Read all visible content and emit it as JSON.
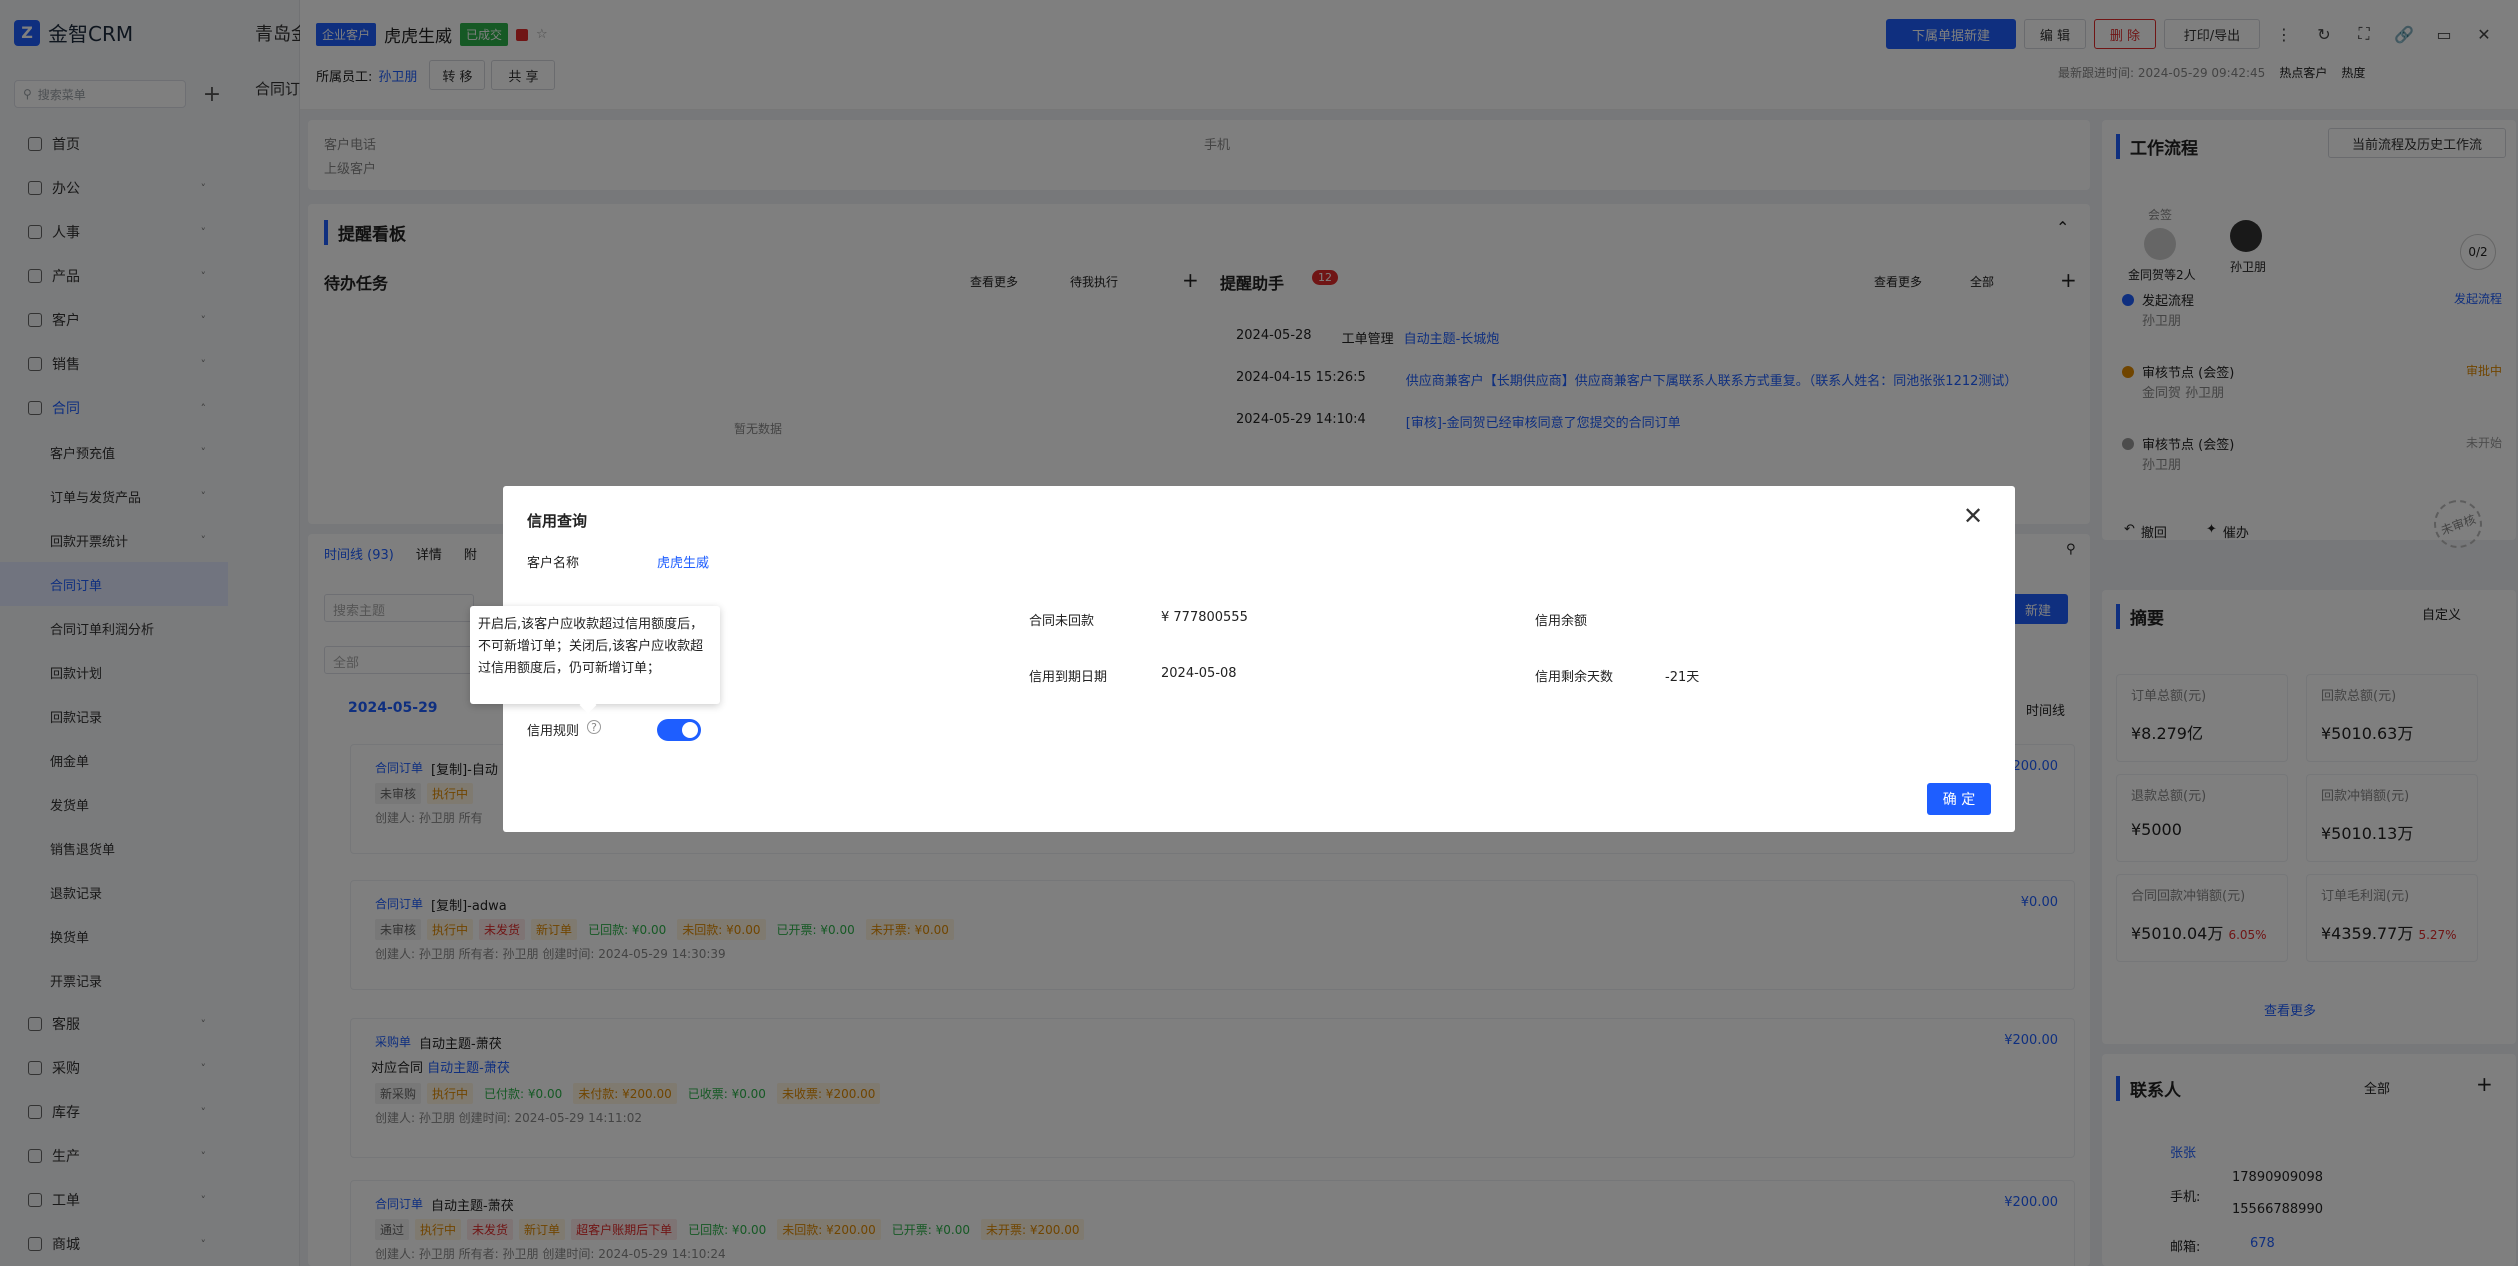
{
  "app": {
    "brand": "金智CRM",
    "search_placeholder": "搜索菜单",
    "top_tab": "青岛金",
    "sub_tab": "合同订"
  },
  "nav": [
    {
      "label": "首页"
    },
    {
      "label": "办公"
    },
    {
      "label": "人事"
    },
    {
      "label": "产品"
    },
    {
      "label": "客户"
    },
    {
      "label": "销售"
    },
    {
      "label": "合同"
    },
    {
      "label": "客户预充值",
      "sub": true
    },
    {
      "label": "订单与发货产品",
      "sub": true
    },
    {
      "label": "回款开票统计",
      "sub": true
    },
    {
      "label": "合同订单",
      "sub": true
    },
    {
      "label": "合同订单利润分析",
      "sub": true
    },
    {
      "label": "回款计划",
      "sub": true
    },
    {
      "label": "回款记录",
      "sub": true
    },
    {
      "label": "佣金单",
      "sub": true
    },
    {
      "label": "发货单",
      "sub": true
    },
    {
      "label": "销售退货单",
      "sub": true
    },
    {
      "label": "退款记录",
      "sub": true
    },
    {
      "label": "换货单",
      "sub": true
    },
    {
      "label": "开票记录",
      "sub": true
    },
    {
      "label": "客服"
    },
    {
      "label": "采购"
    },
    {
      "label": "库存"
    },
    {
      "label": "生产"
    },
    {
      "label": "工单"
    },
    {
      "label": "商城"
    }
  ],
  "header": {
    "tag_type": "企业客户",
    "customer_name": "虎虎生威",
    "tag_status": "已成交",
    "owner_label": "所属员工:",
    "owner": "孙卫朋",
    "transfer": "转 移",
    "share": "共 享",
    "new_order": "下属单据新建",
    "edit": "编 辑",
    "delete": "删 除",
    "print": "打印/导出",
    "latest_follow": "最新跟进时间: 2024-05-29 09:42:45",
    "hot_label": "热点客户",
    "heat": "热度"
  },
  "info": {
    "phone_label": "客户电话",
    "mobile_label": "手机",
    "parent_label": "上级客户"
  },
  "reminder_board": {
    "title": "提醒看板"
  },
  "todo": {
    "title": "待办任务",
    "more": "查看更多",
    "filter": "待我执行",
    "empty": "暂无数据"
  },
  "assistant": {
    "title": "提醒助手",
    "count": "12",
    "more": "查看更多",
    "filter": "全部",
    "items": [
      {
        "time": "2024-05-28",
        "type": "工单管理",
        "text": "自动主题-长城炮"
      },
      {
        "time": "2024-04-15 15:26:5",
        "type": "",
        "text": "供应商兼客户【长期供应商】供应商兼客户下属联系人联系方式重复。（联系人姓名：同池张张1212测试）"
      },
      {
        "time": "2024-05-29 14:10:4",
        "type": "",
        "text": "[审核]-金同贺已经审核同意了您提交的合同订单"
      }
    ]
  },
  "timeline_tabs": {
    "timeline": "时间线 (93)",
    "detail": "详情",
    "more": "附",
    "search_placeholder": "搜索主题",
    "filter": "全部",
    "date": "2024-05-29",
    "view": "时间线",
    "new_btn": "新建"
  },
  "timeline": [
    {
      "type": "合同订单",
      "title": "[复制]-自动",
      "amount": "¥200.00",
      "badges": [
        "未审核",
        "执行中"
      ],
      "meta": "创建人: 孙卫朋   所有"
    },
    {
      "type": "合同订单",
      "title": "[复制]-adwa",
      "amount": "¥0.00",
      "badges": [
        "未审核",
        "执行中",
        "未发货",
        "新订单"
      ],
      "stats": [
        "已回款: ¥0.00",
        "未回款: ¥0.00",
        "已开票: ¥0.00",
        "未开票: ¥0.00"
      ],
      "meta": "创建人: 孙卫朋    所有者: 孙卫朋    创建时间: 2024-05-29 14:30:39"
    },
    {
      "type": "采购单",
      "title": "自动主题-萧茯",
      "amount": "¥200.00",
      "sub": "对应合同",
      "sub_link": "自动主题-萧茯",
      "badges": [
        "新采购",
        "执行中"
      ],
      "stats": [
        "已付款: ¥0.00",
        "未付款: ¥200.00",
        "已收票: ¥0.00",
        "未收票: ¥200.00"
      ],
      "meta": "创建人: 孙卫朋    创建时间: 2024-05-29 14:11:02"
    },
    {
      "type": "合同订单",
      "title": "自动主题-萧茯",
      "amount": "¥200.00",
      "badges": [
        "通过",
        "执行中",
        "未发货",
        "新订单",
        "超客户账期后下单"
      ],
      "stats": [
        "已回款: ¥0.00",
        "未回款: ¥200.00",
        "已开票: ¥0.00",
        "未开票: ¥200.00"
      ],
      "meta": "创建人: 孙卫朋    所有者: 孙卫朋    创建时间: 2024-05-29 14:10:24"
    }
  ],
  "workflow": {
    "title": "工作流程",
    "history_btn": "当前流程及历史工作流",
    "sign": "会签",
    "signers": "金同贺等2人",
    "user": "孙卫朋",
    "count": "0/2",
    "steps": [
      {
        "name": "发起流程",
        "who": "孙卫朋",
        "status": "发起流程"
      },
      {
        "name": "审核节点 (会签)",
        "who": "金同贺 孙卫朋",
        "status": "审批中"
      },
      {
        "name": "审核节点 (会签)",
        "who": "孙卫朋",
        "status": "未开始"
      }
    ],
    "withdraw": "撤回",
    "urge": "催办",
    "stamp": "未审核"
  },
  "summary": {
    "title": "摘要",
    "custom": "自定义",
    "stats": [
      {
        "label": "订单总额(元)",
        "value": "¥8.279亿",
        "pct": ""
      },
      {
        "label": "回款总额(元)",
        "value": "¥5010.63万",
        "pct": ""
      },
      {
        "label": "退款总额(元)",
        "value": "¥5000",
        "pct": ""
      },
      {
        "label": "回款冲销额(元)",
        "value": "¥5010.13万",
        "pct": ""
      },
      {
        "label": "合同回款冲销额(元)",
        "value": "¥5010.04万",
        "pct": "6.05%"
      },
      {
        "label": "订单毛利润(元)",
        "value": "¥4359.77万",
        "pct": "5.27%"
      }
    ],
    "more": "查看更多"
  },
  "contacts": {
    "title": "联系人",
    "filter": "全部",
    "name": "张张",
    "phone_label": "手机:",
    "phones": [
      "17890909098",
      "15566788990"
    ],
    "email_label": "邮箱:",
    "email": "678"
  },
  "modal": {
    "title": "信用查询",
    "customer_label": "客户名称",
    "customer_value": "虎虎生威",
    "unpaid_label": "合同未回款",
    "unpaid_value": "¥ 777800555",
    "balance_label": "信用余额",
    "due_label": "信用到期日期",
    "due_value": "2024-05-08",
    "days_label": "信用剩余天数",
    "days_value": "-21天",
    "rule_label": "信用规则",
    "rule_enabled": true,
    "tooltip": "开启后,该客户应收款超过信用额度后，不可新增订单；关闭后,该客户应收款超过信用额度后，仍可新增订单；",
    "ok": "确 定"
  }
}
